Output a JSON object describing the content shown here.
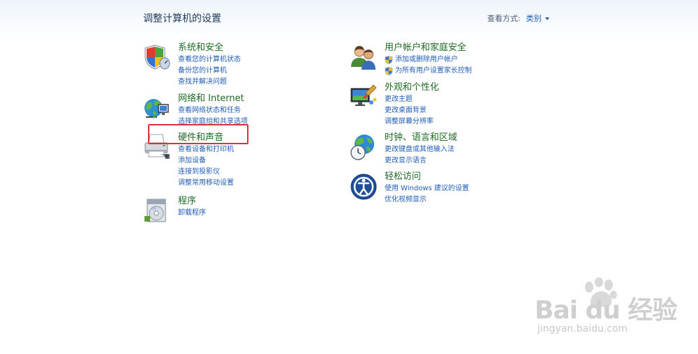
{
  "header": {
    "title": "调整计算机的设置",
    "view_label": "查看方式:",
    "view_value": "类别"
  },
  "left_column": [
    {
      "id": "system-security",
      "title": "系统和安全",
      "icon": "shield-icon",
      "links": [
        "查看您的计算机状态",
        "备份您的计算机",
        "查找并解决问题"
      ]
    },
    {
      "id": "network-internet",
      "title": "网络和 Internet",
      "icon": "network-globe-icon",
      "links": [
        "查看网络状态和任务",
        "选择家庭组和共享选项"
      ]
    },
    {
      "id": "hardware-sound",
      "title": "硬件和声音",
      "icon": "printer-icon",
      "links": [
        "查看设备和打印机",
        "添加设备",
        "连接到投影仪",
        "调整常用移动设置"
      ]
    },
    {
      "id": "programs",
      "title": "程序",
      "icon": "programs-icon",
      "links": [
        "卸载程序"
      ]
    }
  ],
  "right_column": [
    {
      "id": "user-accounts",
      "title": "用户帐户和家庭安全",
      "icon": "users-icon",
      "links": [
        "添加或删除用户帐户",
        "为所有用户设置家长控制"
      ]
    },
    {
      "id": "appearance",
      "title": "外观和个性化",
      "icon": "monitor-icon",
      "links": [
        "更改主题",
        "更改桌面背景",
        "调整屏幕分辨率"
      ]
    },
    {
      "id": "clock-region",
      "title": "时钟、语言和区域",
      "icon": "clock-globe-icon",
      "links": [
        "更改键盘或其他输入法",
        "更改显示语言"
      ]
    },
    {
      "id": "ease-of-access",
      "title": "轻松访问",
      "icon": "ease-of-access-icon",
      "links": [
        "使用 Windows 建议的设置",
        "优化视频显示"
      ]
    }
  ],
  "watermark": {
    "brand": "Bai du 经验",
    "url": "jingyan.baidu.com"
  },
  "colors": {
    "category_title": "#1d6a23",
    "link": "#1f5db5",
    "heading": "#1e395b",
    "highlight": "#d9323c"
  }
}
